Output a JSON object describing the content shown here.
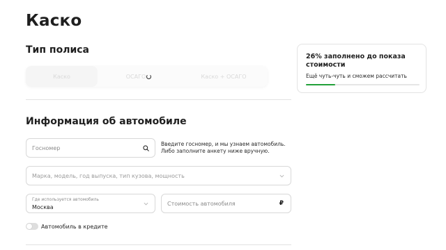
{
  "page": {
    "title": "Каско"
  },
  "policy": {
    "title": "Тип полиса",
    "tabs": [
      {
        "label": "Каско"
      },
      {
        "label": "ОСАГО"
      },
      {
        "label": "Каско + ОСАГО"
      }
    ]
  },
  "car": {
    "title": "Информация об автомобиле",
    "gosnomer": {
      "placeholder": "Госномер"
    },
    "hint": "Введите госномер, и мы узнаем автомобиль. Либо заполните анкету ниже вручную.",
    "model": {
      "placeholder": "Марка, модель, год выпуска, тип кузова, мощность"
    },
    "usage": {
      "label": "Где используется автомобиль",
      "value": "Москва"
    },
    "cost": {
      "placeholder": "Стоимость автомобиля",
      "currency": "₽"
    },
    "credit": {
      "label": "Автомобиль в кредите",
      "enabled": false
    }
  },
  "progress": {
    "title": "26% заполнено до показа стоимости",
    "subtitle": "Ещё чуть-чуть и сможем рассчитать",
    "percent": 26,
    "color": "#21a038"
  }
}
